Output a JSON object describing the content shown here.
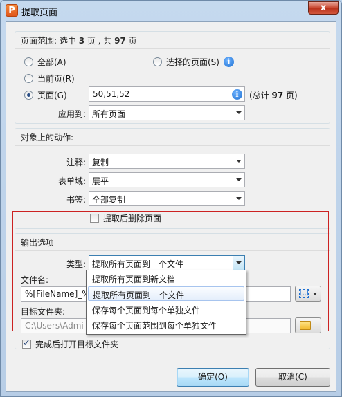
{
  "window": {
    "title": "提取页面",
    "close_label": "x"
  },
  "page_range": {
    "title_prefix": "页面范围: 选中 ",
    "selected_count": "3",
    "title_middle": " 页 , 共 ",
    "total_count": "97",
    "title_suffix": " 页",
    "options": {
      "all": "全部(A)",
      "current": "当前页(R)",
      "pages": "页面(G)",
      "selected": "选择的页面(S)"
    },
    "pages_value": "50,51,52",
    "total_prefix": "(总计 ",
    "total_bold": "97",
    "total_suffix": " 页)",
    "apply_label": "应用到:",
    "apply_value": "所有页面"
  },
  "actions": {
    "title": "对象上的动作:",
    "annotation_label": "注释:",
    "annotation_value": "复制",
    "form_label": "表单域:",
    "form_value": "展平",
    "bookmark_label": "书签:",
    "bookmark_value": "全部复制",
    "delete_after_label": "提取后删除页面"
  },
  "output": {
    "title": "输出选项",
    "type_label": "类型:",
    "type_value": "提取所有页面到一个文件",
    "type_options": [
      "提取所有页面到新文档",
      "提取所有页面到一个文件",
      "保存每个页面到每个单独文件",
      "保存每个页面范围到每个单独文件"
    ],
    "filename_label": "文件名:",
    "filename_value": "%[FileName]_%",
    "folder_label": "目标文件夹:",
    "folder_value": "C:\\Users\\Admi",
    "open_folder_label": "完成后打开目标文件夹"
  },
  "buttons": {
    "ok": "确定(O)",
    "cancel": "取消(C)"
  },
  "icons": {
    "app": "P",
    "info": "i",
    "token": "[..]"
  },
  "colors": {
    "highlight": "#cc2222",
    "accent": "#3c7fb1",
    "info": "#1d6fd1"
  }
}
